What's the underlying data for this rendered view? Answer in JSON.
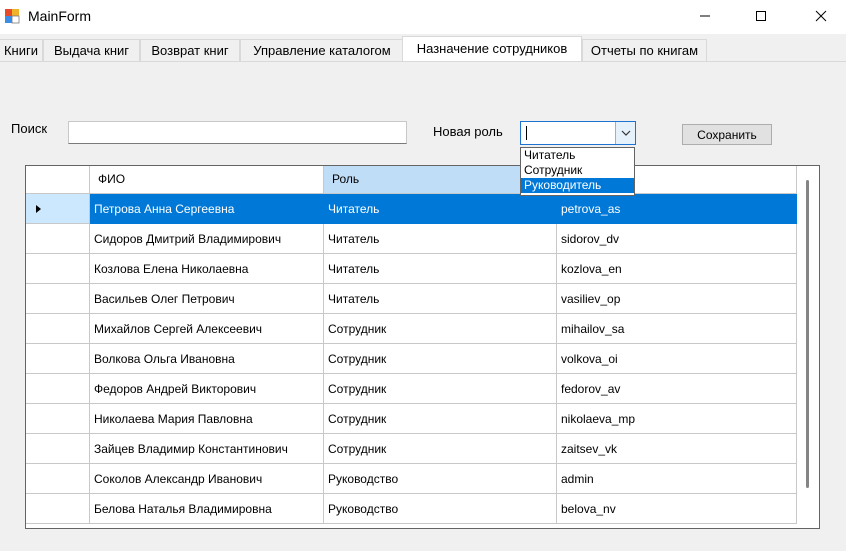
{
  "window": {
    "title": "MainForm"
  },
  "tabs": [
    {
      "label": "Книги"
    },
    {
      "label": "Выдача книг"
    },
    {
      "label": "Возврат книг"
    },
    {
      "label": "Управление каталогом"
    },
    {
      "label": "Назначение сотрудников",
      "active": true
    },
    {
      "label": "Отчеты по книгам"
    }
  ],
  "search": {
    "label": "Поиск",
    "value": ""
  },
  "role": {
    "label": "Новая роль",
    "value": "",
    "options": [
      "Читатель",
      "Сотрудник",
      "Руководитель"
    ],
    "highlighted": "Руководитель"
  },
  "save_label": "Сохранить",
  "grid": {
    "columns": [
      "",
      "ФИО",
      "Роль",
      ""
    ],
    "rows": [
      {
        "name": "Петрова Анна Сергеевна",
        "role": "Читатель",
        "login": "petrova_as",
        "selected": true
      },
      {
        "name": "Сидоров Дмитрий Владимирович",
        "role": "Читатель",
        "login": "sidorov_dv"
      },
      {
        "name": "Козлова Елена Николаевна",
        "role": "Читатель",
        "login": "kozlova_en"
      },
      {
        "name": "Васильев Олег Петрович",
        "role": "Читатель",
        "login": "vasiliev_op"
      },
      {
        "name": "Михайлов Сергей Алексеевич",
        "role": "Сотрудник",
        "login": "mihailov_sa"
      },
      {
        "name": "Волкова Ольга Ивановна",
        "role": "Сотрудник",
        "login": "volkova_oi"
      },
      {
        "name": "Федоров Андрей Викторович",
        "role": "Сотрудник",
        "login": "fedorov_av"
      },
      {
        "name": "Николаева Мария Павловна",
        "role": "Сотрудник",
        "login": "nikolaeva_mp"
      },
      {
        "name": "Зайцев Владимир Константинович",
        "role": "Сотрудник",
        "login": "zaitsev_vk"
      },
      {
        "name": "Соколов Александр Иванович",
        "role": "Руководство",
        "login": "admin"
      },
      {
        "name": "Белова Наталья Владимировна",
        "role": "Руководство",
        "login": "belova_nv"
      }
    ]
  },
  "colors": {
    "accent": "#0078d7",
    "header_sorted": "#bfddf7",
    "background": "#f0f0f0"
  },
  "icons": [
    "app-icon",
    "minimize-icon",
    "maximize-icon",
    "close-icon",
    "dropdown-arrow-icon",
    "row-pointer-icon"
  ]
}
